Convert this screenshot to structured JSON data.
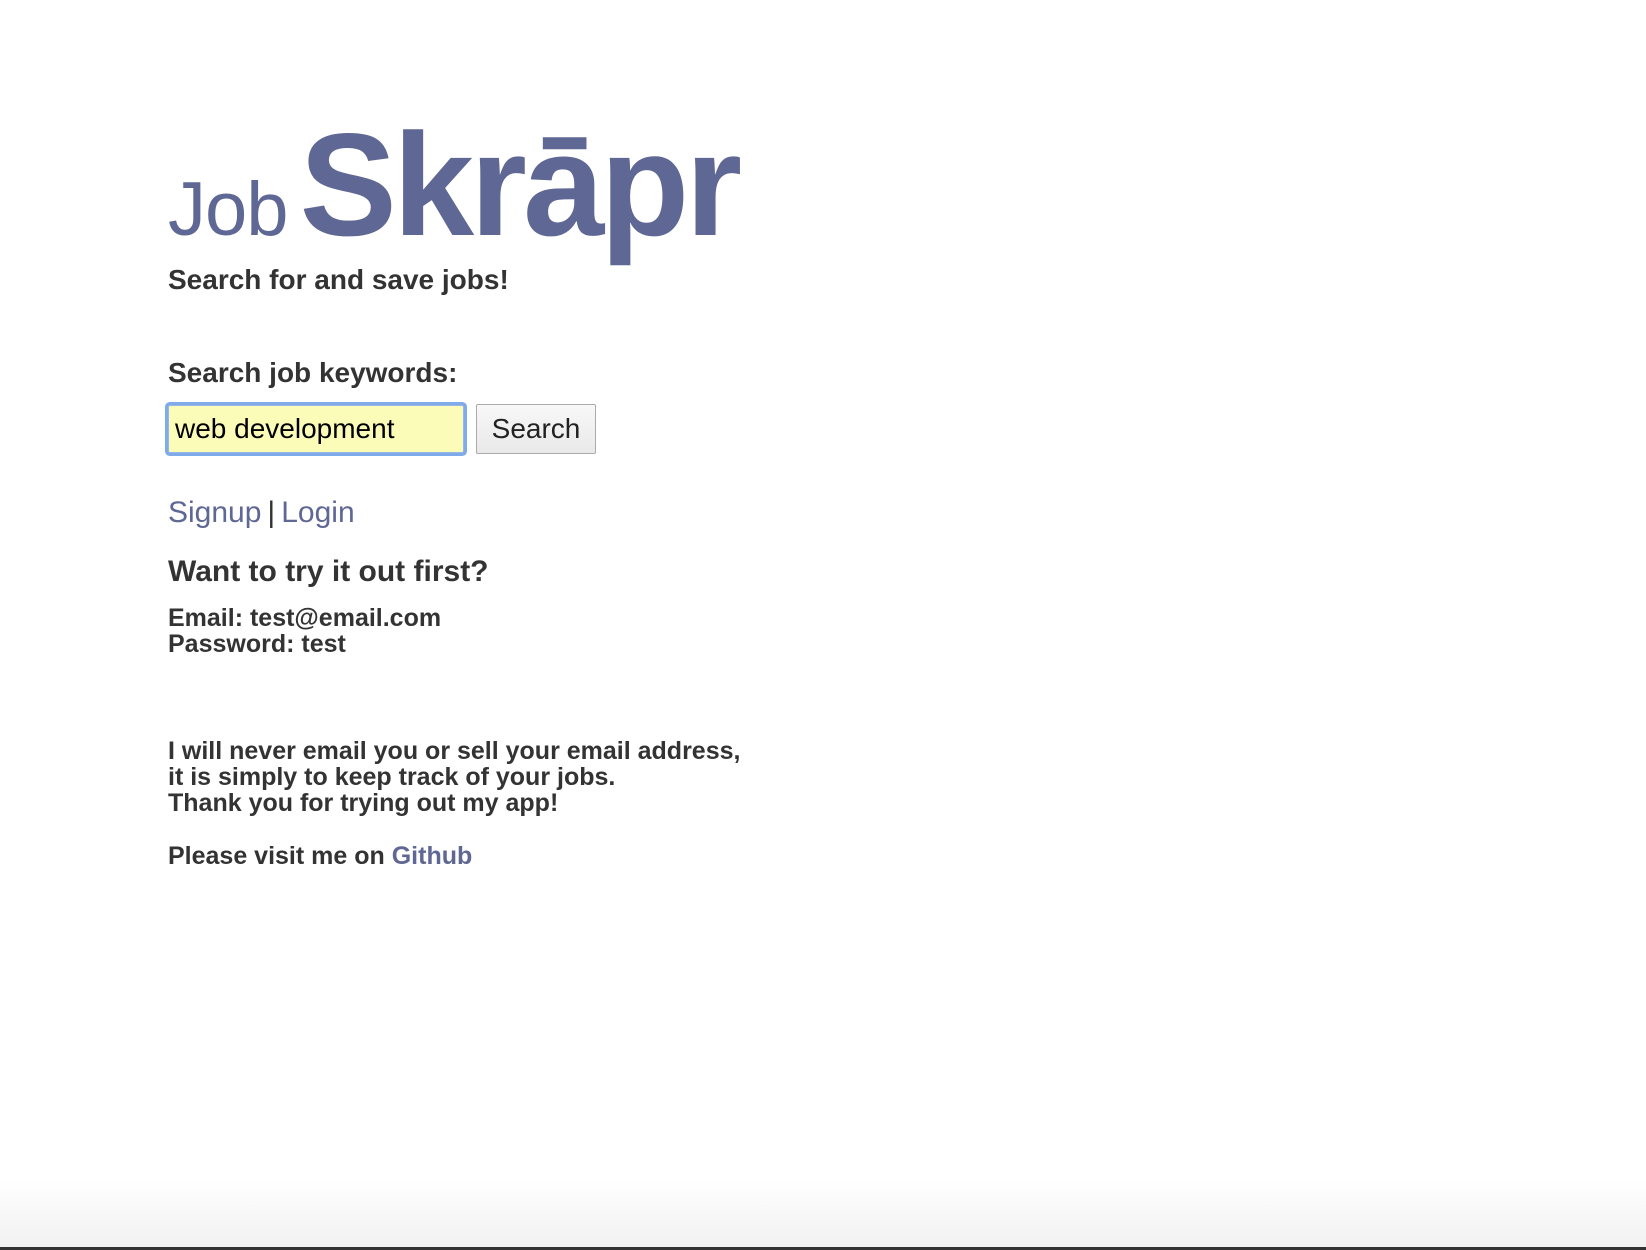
{
  "logo": {
    "job": "Job",
    "skrapr": "Skrāpr"
  },
  "tagline": "Search for and save jobs!",
  "search": {
    "label": "Search job keywords:",
    "value": "web development",
    "button_label": "Search"
  },
  "auth": {
    "signup": "Signup",
    "separator": "|",
    "login": "Login"
  },
  "trial": {
    "heading": "Want to try it out first?",
    "email": "Email: test@email.com",
    "password": "Password: test"
  },
  "disclaimer": {
    "line1": "I will never email you or sell your email address,",
    "line2": "it is simply to keep track of your jobs.",
    "line3": "Thank you for trying out my app!"
  },
  "github": {
    "prefix": "Please visit me on",
    "link": "Github"
  },
  "colors": {
    "brand": "#5f6794",
    "text": "#333333",
    "input_bg": "#fafcb8",
    "focus_ring": "#7fabea"
  }
}
